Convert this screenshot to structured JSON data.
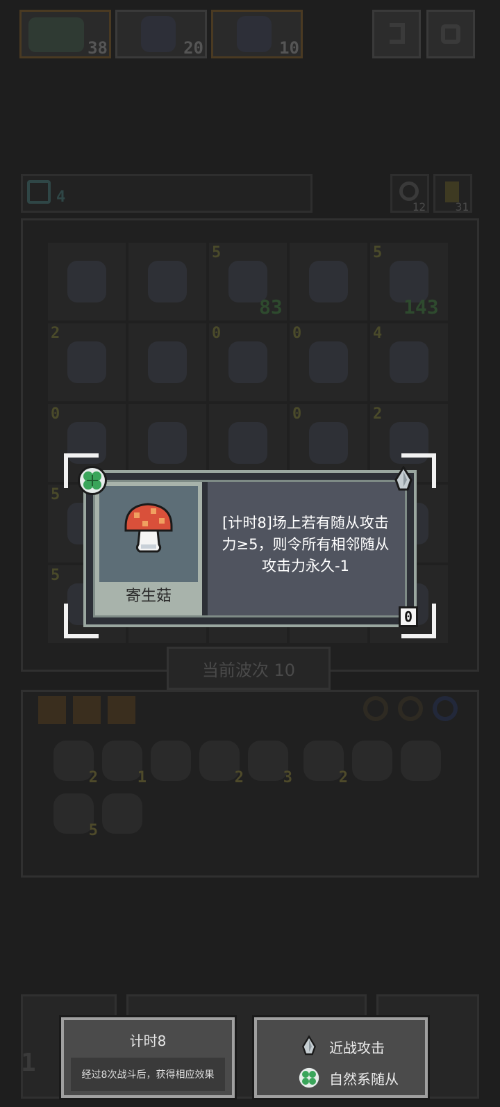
{
  "top_bar": {
    "cards": [
      {
        "count": "38",
        "border": "#4a3a22"
      },
      {
        "count": "20",
        "border": "#3a3a3a"
      },
      {
        "count": "10",
        "border": "#4a3a22"
      }
    ]
  },
  "status_row": {
    "left_counter": "4",
    "right_counters": [
      "12",
      "31"
    ]
  },
  "board": {
    "cells": [
      [
        "",
        "",
        "5",
        "",
        "5"
      ],
      [
        "2",
        "",
        "0",
        "0",
        "4"
      ],
      [
        "0",
        "",
        "",
        "0",
        "2"
      ],
      [
        "5",
        "",
        "",
        "",
        ""
      ],
      [
        "5",
        "",
        "",
        "",
        ""
      ]
    ],
    "side_stats": [
      "83",
      "143"
    ]
  },
  "wave_label": "当前波次 10",
  "inventory": {
    "counts": [
      "2",
      "1",
      "",
      "2",
      "3",
      "2",
      "",
      "",
      "5",
      ""
    ]
  },
  "popup": {
    "name": "寄生菇",
    "description_lines": [
      "[计时8]场上若有随从攻击",
      "力≥5，则令所有相邻随从",
      "攻击力永久-1"
    ],
    "corner_value": "0",
    "colors": {
      "nature_badge": "#3aa55a",
      "cap": "#d9503a",
      "frame": "#9aa7a0"
    }
  },
  "tooltips": {
    "timer": {
      "title": "计时8",
      "desc": "经过8次战斗后，获得相应效果"
    },
    "tags": [
      {
        "icon": "melee-attack-icon",
        "label": "近战攻击"
      },
      {
        "icon": "nature-minion-icon",
        "label": "自然系随从"
      }
    ]
  },
  "bottom_left_digit": "1"
}
